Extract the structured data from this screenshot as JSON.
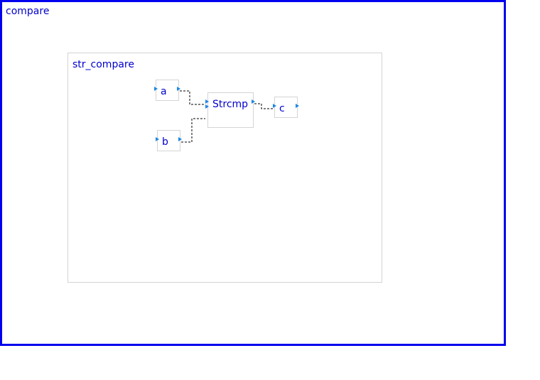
{
  "diagram": {
    "outer_title": "compare",
    "subsystem_title": "str_compare",
    "blocks": {
      "input_a": "a",
      "input_b": "b",
      "function": "Strcmp",
      "output_c": "c"
    }
  },
  "colors": {
    "outer_border": "#0000ee",
    "label_text": "#0000cc",
    "block_border": "#d4d4d4",
    "port_arrow": "#1e88e5",
    "wire": "#000000"
  }
}
